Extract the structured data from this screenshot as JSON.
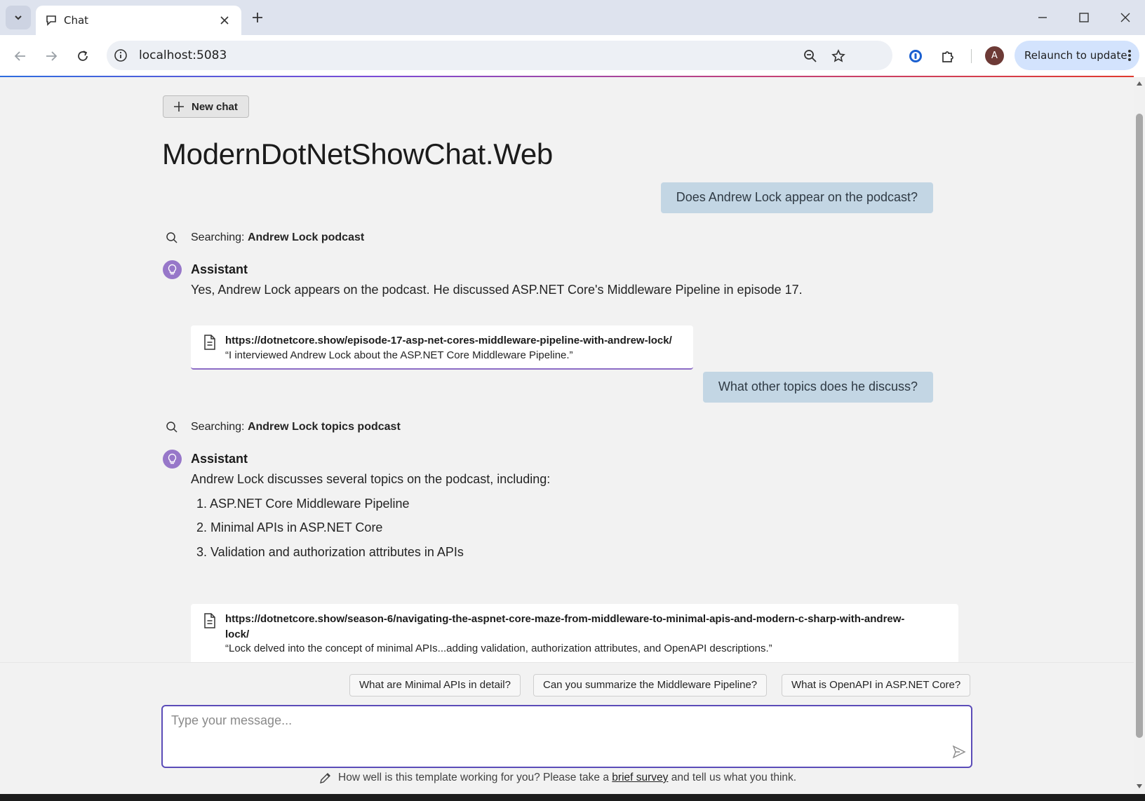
{
  "browser": {
    "tab": {
      "title": "Chat"
    },
    "address_bar": {
      "url": "localhost:5083"
    },
    "relaunch_label": "Relaunch to update",
    "profile_initial": "A",
    "icons": {
      "tab_list": "chevron-down-icon",
      "favicon": "chat-bubble-icon",
      "close_tab": "close-icon",
      "new_tab": "plus-icon",
      "minimize": "minimize-icon",
      "maximize": "maximize-icon",
      "close_window": "close-icon",
      "back": "back-arrow-icon",
      "forward": "forward-arrow-icon",
      "reload": "reload-icon",
      "site_info": "info-icon",
      "zoom": "zoom-out-icon",
      "bookmark": "star-icon",
      "password_manager": "password-manager-icon",
      "extensions": "puzzle-icon",
      "menu": "kebab-menu-icon"
    }
  },
  "page": {
    "new_chat_label": "New chat",
    "title": "ModernDotNetShowChat.Web",
    "accent_color": "#9777c9",
    "user_bubble_color": "#c3d6e4"
  },
  "conversation": {
    "turn1": {
      "user": "Does Andrew Lock appear on the podcast?",
      "search_prefix": "Searching:",
      "search_query": "Andrew Lock podcast",
      "assistant_name": "Assistant",
      "answer": "Yes, Andrew Lock appears on the podcast. He discussed ASP.NET Core's Middleware Pipeline in episode 17.",
      "citation": {
        "url": "https://dotnetcore.show/episode-17-asp-net-cores-middleware-pipeline-with-andrew-lock/",
        "quote": "“I interviewed Andrew Lock about the ASP.NET Core Middleware Pipeline.”"
      }
    },
    "turn2": {
      "user": "What other topics does he discuss?",
      "search_prefix": "Searching:",
      "search_query": "Andrew Lock topics podcast",
      "assistant_name": "Assistant",
      "intro": "Andrew Lock discusses several topics on the podcast, including:",
      "list": [
        "1. ASP.NET Core Middleware Pipeline",
        "2. Minimal APIs in ASP.NET Core",
        "3. Validation and authorization attributes in APIs"
      ],
      "citation": {
        "url_line1": "https://dotnetcore.show/season-6/navigating-the-aspnet-core-maze-from-middleware-to-minimal-apis-and-modern-c-sharp-with-andrew-",
        "url_line2": "lock/",
        "quote": "“Lock delved into the concept of minimal APIs...adding validation, authorization attributes, and OpenAPI descriptions.”"
      }
    }
  },
  "suggestions": [
    "What are Minimal APIs in detail?",
    "Can you summarize the Middleware Pipeline?",
    "What is OpenAPI in ASP.NET Core?"
  ],
  "composer": {
    "placeholder": "Type your message...",
    "send_icon": "send-icon"
  },
  "survey": {
    "text_before": "How well is this template working for you? Please take a",
    "link_text": "brief survey",
    "text_after": "and tell us what you think."
  }
}
